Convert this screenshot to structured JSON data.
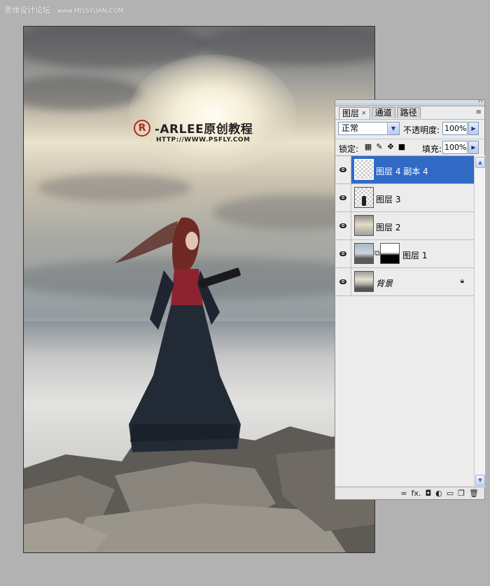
{
  "watermark": {
    "cn": "思缘设计论坛",
    "url": "www.MISSYUAN.COM"
  },
  "canvas": {
    "logo_mark": "R",
    "logo_title": "-ARLEE原创教程",
    "logo_url": "HTTP://WWW.PSFLY.COM"
  },
  "panel": {
    "tabs": [
      {
        "label": "图层",
        "close": "×"
      },
      {
        "label": "通道"
      },
      {
        "label": "路径"
      }
    ],
    "menu_icon": "≡",
    "blend_mode": "正常",
    "opacity_label": "不透明度:",
    "opacity_value": "100%",
    "lock_label": "锁定:",
    "fill_label": "填充:",
    "fill_value": "100%",
    "layers": [
      {
        "name": "图层 4 副本 4",
        "selected": true
      },
      {
        "name": "图层 3"
      },
      {
        "name": "图层 2"
      },
      {
        "name": "图层 1"
      },
      {
        "name": "背景",
        "locked": true
      }
    ],
    "bottom_icons": [
      "link-icon",
      "fx-icon",
      "mask-icon",
      "adjustment-icon",
      "folder-icon",
      "new-layer-icon",
      "trash-icon"
    ],
    "fx_label": "fx."
  },
  "colors": {
    "selected": "#316ac5",
    "background": "#b2b2b2",
    "logo_red": "#b3261e"
  }
}
